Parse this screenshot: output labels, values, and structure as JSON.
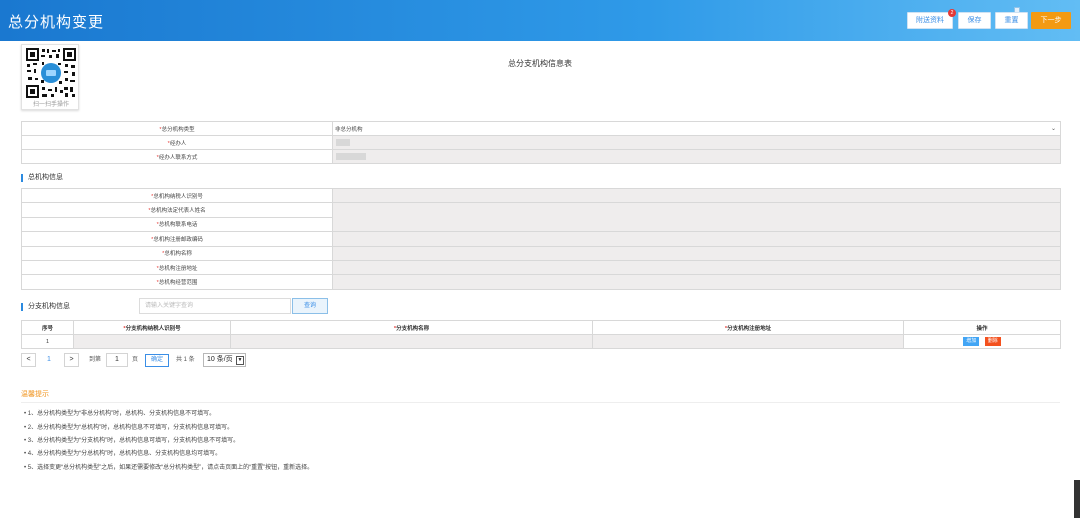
{
  "header": {
    "title": "总分机构变更",
    "buttons": {
      "attach": "附送资料",
      "attach_badge": "2",
      "save": "保存",
      "reset": "重置",
      "next": "下一步"
    }
  },
  "qr": {
    "caption": "扫一扫手操作"
  },
  "form_title": "总分支机构信息表",
  "basic": {
    "type_label": "总分机构类型",
    "type_value": "非总分机构",
    "handler_label": "经办人",
    "contact_label": "经办人联系方式"
  },
  "hq": {
    "section": "总机构信息",
    "fields": [
      "总机构纳税人识别号",
      "总机构法定代表人姓名",
      "总机构联系电话",
      "总机构注册邮政编码",
      "总机构名称",
      "总机构注册地址",
      "总机构经营范围"
    ]
  },
  "branch": {
    "section": "分支机构信息",
    "search_placeholder": "请输入关键字查询",
    "query": "查询",
    "columns": [
      "序号",
      "分支机构纳税人识别号",
      "分支机构名称",
      "分支机构注册地址",
      "操作"
    ],
    "row_no": "1",
    "add": "增加",
    "delete": "删除"
  },
  "pagination": {
    "prev": "<",
    "current": "1",
    "next": ">",
    "goto": "到第",
    "page_input": "1",
    "page_unit": "页",
    "confirm": "确定",
    "total": "共 1 条",
    "page_size": "10 条/页"
  },
  "tips": {
    "title": "温馨提示",
    "items": [
      "1、总分机构类型为“非总分机构”时，总机构、分支机构信息不可填写。",
      "2、总分机构类型为“总机构”时，总机构信息不可填写，分支机构信息可填写。",
      "3、总分机构类型为“分支机构”时，总机构信息可填写，分支机构信息不可填写。",
      "4、总分机构类型为“分总机构”时，总机构信息、分支机构信息均可填写。",
      "5、选择变更“总分机构类型”之后，如果还需要修改“总分机构类型”，请点击页面上的“重置”按钮，重新选择。"
    ]
  },
  "colors": {
    "header_start": "#1a78d0",
    "header_end": "#62bdf4",
    "accent": "#3a8ee6",
    "next_button": "#f39a12",
    "required": "#e53935",
    "tips_title": "#f0941f"
  }
}
